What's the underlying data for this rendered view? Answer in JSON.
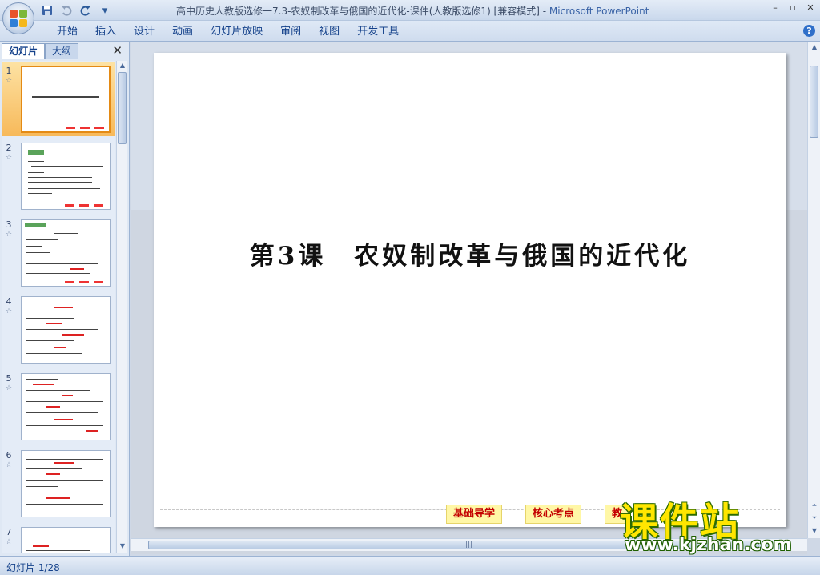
{
  "window": {
    "title": "高中历史人教版选修一7.3-农奴制改革与俄国的近代化-课件(人教版选修1) [兼容模式]",
    "separator": " - ",
    "app_name": "Microsoft PowerPoint",
    "controls": [
      "–",
      "▫",
      "✕"
    ]
  },
  "qat": {
    "save_icon": "floppy-disk-icon",
    "undo_icon": "undo-icon",
    "redo_icon": "redo-icon",
    "customize": "▾"
  },
  "ribbon": {
    "tabs": [
      "开始",
      "插入",
      "设计",
      "动画",
      "幻灯片放映",
      "审阅",
      "视图",
      "开发工具"
    ],
    "help": "?"
  },
  "left_panel": {
    "tabs": [
      "幻灯片",
      "大纲"
    ],
    "close": "✕",
    "slides": [
      {
        "number": "1",
        "selected": true
      },
      {
        "number": "2",
        "selected": false
      },
      {
        "number": "3",
        "selected": false
      },
      {
        "number": "4",
        "selected": false
      },
      {
        "number": "5",
        "selected": false
      },
      {
        "number": "6",
        "selected": false
      },
      {
        "number": "7",
        "selected": false
      }
    ],
    "star": "☆"
  },
  "slide": {
    "title": "第3课　农奴制改革与俄国的近代化",
    "buttons": [
      "基础导学",
      "核心考点",
      "教"
    ]
  },
  "status": {
    "text": "幻灯片 1/28"
  },
  "watermark": {
    "title": "课件站",
    "url": "www.kjzhan.com"
  },
  "colors": {
    "accent": "#15428b",
    "selected_thumb": "#f7b95a",
    "button_bg": "#fff7a6",
    "button_text": "#c40000"
  }
}
